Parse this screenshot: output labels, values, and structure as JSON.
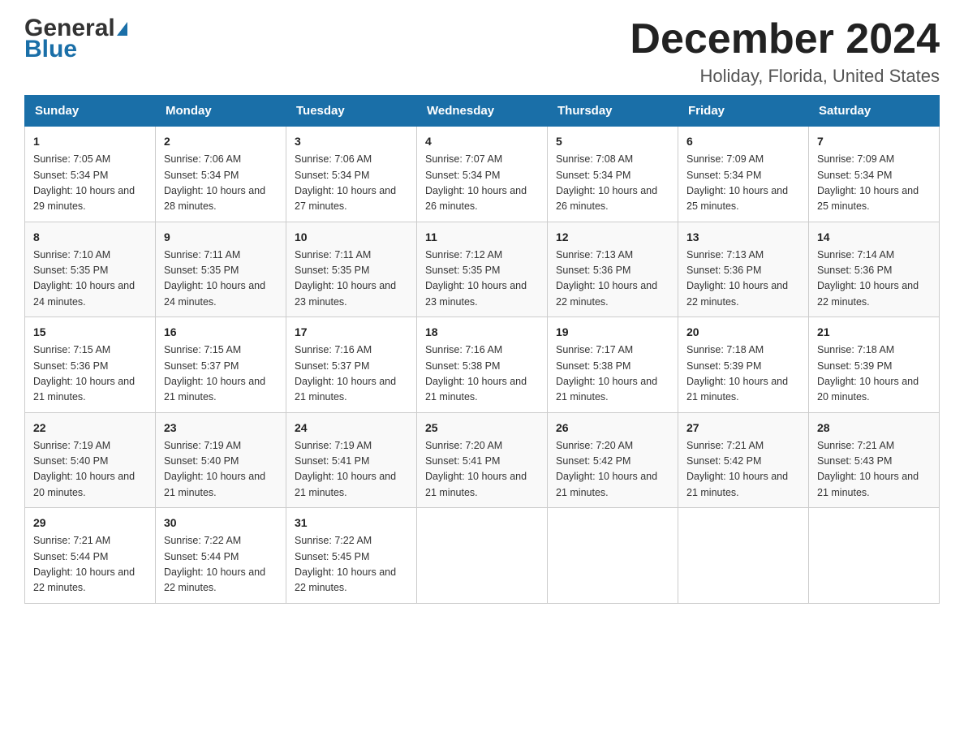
{
  "header": {
    "logo_text_general": "General",
    "logo_text_blue": "Blue",
    "month_year": "December 2024",
    "location": "Holiday, Florida, United States"
  },
  "days_of_week": [
    "Sunday",
    "Monday",
    "Tuesday",
    "Wednesday",
    "Thursday",
    "Friday",
    "Saturday"
  ],
  "weeks": [
    [
      {
        "day": "1",
        "sunrise": "7:05 AM",
        "sunset": "5:34 PM",
        "daylight": "10 hours and 29 minutes."
      },
      {
        "day": "2",
        "sunrise": "7:06 AM",
        "sunset": "5:34 PM",
        "daylight": "10 hours and 28 minutes."
      },
      {
        "day": "3",
        "sunrise": "7:06 AM",
        "sunset": "5:34 PM",
        "daylight": "10 hours and 27 minutes."
      },
      {
        "day": "4",
        "sunrise": "7:07 AM",
        "sunset": "5:34 PM",
        "daylight": "10 hours and 26 minutes."
      },
      {
        "day": "5",
        "sunrise": "7:08 AM",
        "sunset": "5:34 PM",
        "daylight": "10 hours and 26 minutes."
      },
      {
        "day": "6",
        "sunrise": "7:09 AM",
        "sunset": "5:34 PM",
        "daylight": "10 hours and 25 minutes."
      },
      {
        "day": "7",
        "sunrise": "7:09 AM",
        "sunset": "5:34 PM",
        "daylight": "10 hours and 25 minutes."
      }
    ],
    [
      {
        "day": "8",
        "sunrise": "7:10 AM",
        "sunset": "5:35 PM",
        "daylight": "10 hours and 24 minutes."
      },
      {
        "day": "9",
        "sunrise": "7:11 AM",
        "sunset": "5:35 PM",
        "daylight": "10 hours and 24 minutes."
      },
      {
        "day": "10",
        "sunrise": "7:11 AM",
        "sunset": "5:35 PM",
        "daylight": "10 hours and 23 minutes."
      },
      {
        "day": "11",
        "sunrise": "7:12 AM",
        "sunset": "5:35 PM",
        "daylight": "10 hours and 23 minutes."
      },
      {
        "day": "12",
        "sunrise": "7:13 AM",
        "sunset": "5:36 PM",
        "daylight": "10 hours and 22 minutes."
      },
      {
        "day": "13",
        "sunrise": "7:13 AM",
        "sunset": "5:36 PM",
        "daylight": "10 hours and 22 minutes."
      },
      {
        "day": "14",
        "sunrise": "7:14 AM",
        "sunset": "5:36 PM",
        "daylight": "10 hours and 22 minutes."
      }
    ],
    [
      {
        "day": "15",
        "sunrise": "7:15 AM",
        "sunset": "5:36 PM",
        "daylight": "10 hours and 21 minutes."
      },
      {
        "day": "16",
        "sunrise": "7:15 AM",
        "sunset": "5:37 PM",
        "daylight": "10 hours and 21 minutes."
      },
      {
        "day": "17",
        "sunrise": "7:16 AM",
        "sunset": "5:37 PM",
        "daylight": "10 hours and 21 minutes."
      },
      {
        "day": "18",
        "sunrise": "7:16 AM",
        "sunset": "5:38 PM",
        "daylight": "10 hours and 21 minutes."
      },
      {
        "day": "19",
        "sunrise": "7:17 AM",
        "sunset": "5:38 PM",
        "daylight": "10 hours and 21 minutes."
      },
      {
        "day": "20",
        "sunrise": "7:18 AM",
        "sunset": "5:39 PM",
        "daylight": "10 hours and 21 minutes."
      },
      {
        "day": "21",
        "sunrise": "7:18 AM",
        "sunset": "5:39 PM",
        "daylight": "10 hours and 20 minutes."
      }
    ],
    [
      {
        "day": "22",
        "sunrise": "7:19 AM",
        "sunset": "5:40 PM",
        "daylight": "10 hours and 20 minutes."
      },
      {
        "day": "23",
        "sunrise": "7:19 AM",
        "sunset": "5:40 PM",
        "daylight": "10 hours and 21 minutes."
      },
      {
        "day": "24",
        "sunrise": "7:19 AM",
        "sunset": "5:41 PM",
        "daylight": "10 hours and 21 minutes."
      },
      {
        "day": "25",
        "sunrise": "7:20 AM",
        "sunset": "5:41 PM",
        "daylight": "10 hours and 21 minutes."
      },
      {
        "day": "26",
        "sunrise": "7:20 AM",
        "sunset": "5:42 PM",
        "daylight": "10 hours and 21 minutes."
      },
      {
        "day": "27",
        "sunrise": "7:21 AM",
        "sunset": "5:42 PM",
        "daylight": "10 hours and 21 minutes."
      },
      {
        "day": "28",
        "sunrise": "7:21 AM",
        "sunset": "5:43 PM",
        "daylight": "10 hours and 21 minutes."
      }
    ],
    [
      {
        "day": "29",
        "sunrise": "7:21 AM",
        "sunset": "5:44 PM",
        "daylight": "10 hours and 22 minutes."
      },
      {
        "day": "30",
        "sunrise": "7:22 AM",
        "sunset": "5:44 PM",
        "daylight": "10 hours and 22 minutes."
      },
      {
        "day": "31",
        "sunrise": "7:22 AM",
        "sunset": "5:45 PM",
        "daylight": "10 hours and 22 minutes."
      },
      null,
      null,
      null,
      null
    ]
  ],
  "labels": {
    "sunrise": "Sunrise:",
    "sunset": "Sunset:",
    "daylight": "Daylight:"
  },
  "colors": {
    "header_bg": "#1a6fa8",
    "header_text": "#ffffff",
    "border": "#cccccc",
    "logo_blue": "#1a6fa8"
  }
}
